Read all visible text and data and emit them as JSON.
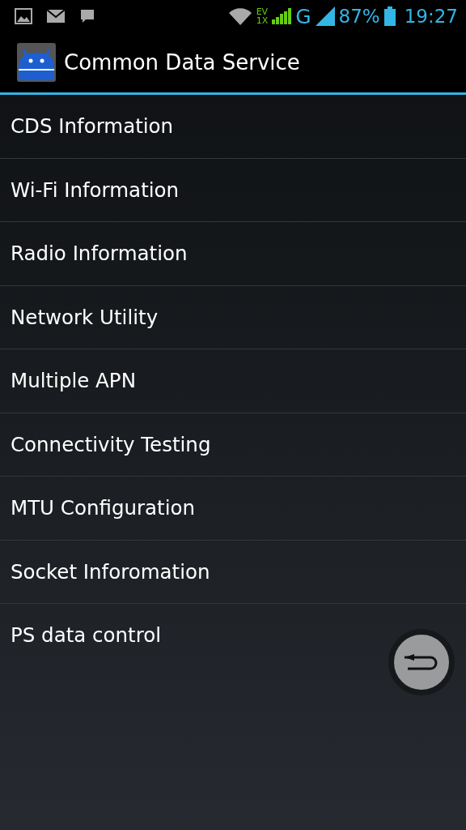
{
  "status_bar": {
    "data_type_top": "EV",
    "data_type_bottom": "1X",
    "network_type": "G",
    "battery": "87%",
    "time": "19:27"
  },
  "action_bar": {
    "title": "Common Data Service"
  },
  "menu_items": [
    {
      "label": "CDS Information"
    },
    {
      "label": "Wi-Fi Information"
    },
    {
      "label": "Radio Information"
    },
    {
      "label": "Network Utility"
    },
    {
      "label": "Multiple APN"
    },
    {
      "label": "Connectivity Testing"
    },
    {
      "label": "MTU Configuration"
    },
    {
      "label": "Socket Inforomation"
    },
    {
      "label": "PS data control"
    }
  ]
}
